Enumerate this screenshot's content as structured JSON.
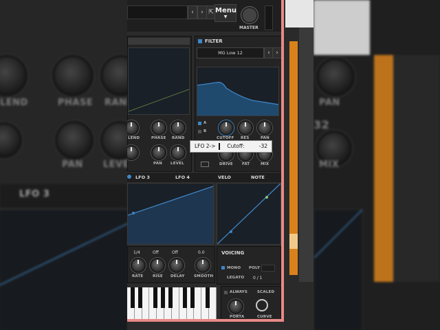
{
  "background_left": {
    "labels": [
      "LEND",
      "PHASE",
      "RAND",
      "PAN",
      "LEVEL"
    ],
    "lfo_tab": "LFO 3"
  },
  "background_right": {
    "labels": [
      "PAN",
      "MIX"
    ],
    "value": "32"
  },
  "topbar": {
    "menu_label": "Menu",
    "master_label": "MASTER",
    "prev_arrow": "‹",
    "next_arrow": "›",
    "expand_icon": "⇱"
  },
  "filter": {
    "title": "FILTER",
    "type": "MG Low 12",
    "route_a": "A",
    "route_b": "B",
    "knobs": [
      {
        "label": "CUTOFF"
      },
      {
        "label": "RES"
      },
      {
        "label": "PAN"
      },
      {
        "label": "DRIVE"
      },
      {
        "label": "FAT"
      },
      {
        "label": "MIX"
      }
    ]
  },
  "osc": {
    "knobs_row1": [
      {
        "label": "LEND"
      },
      {
        "label": "PHASE"
      },
      {
        "label": "RAND"
      }
    ],
    "knobs_row2": [
      {
        "label": "PAN"
      },
      {
        "label": "LEVEL"
      }
    ]
  },
  "tooltip": {
    "text": "LFO 2->",
    "param": "Cutoff:",
    "value": "-32"
  },
  "tabs": {
    "lfo3": "LFO 3",
    "lfo4": "LFO 4",
    "velo": "VELO",
    "note": "NOTE"
  },
  "lfo_controls": [
    {
      "label": "RATE",
      "value": "1/4"
    },
    {
      "label": "RISE",
      "value": "Off"
    },
    {
      "label": "DELAY",
      "value": "Off"
    },
    {
      "label": "SMOOTH",
      "value": "0.0"
    }
  ],
  "voicing": {
    "title": "VOICING",
    "mono": "MONO",
    "poly": "POLY",
    "legato": "LEGATO",
    "voices": "0 / 1",
    "always": "ALWAYS",
    "scaled": "SCALED",
    "porta": "PORTA",
    "curve": "CURVE"
  },
  "colors": {
    "accent_blue": "#3f86c7",
    "graph_fill": "#1f4a6e",
    "daw_orange": "#d9821c",
    "frame_pink": "#e88a88"
  }
}
